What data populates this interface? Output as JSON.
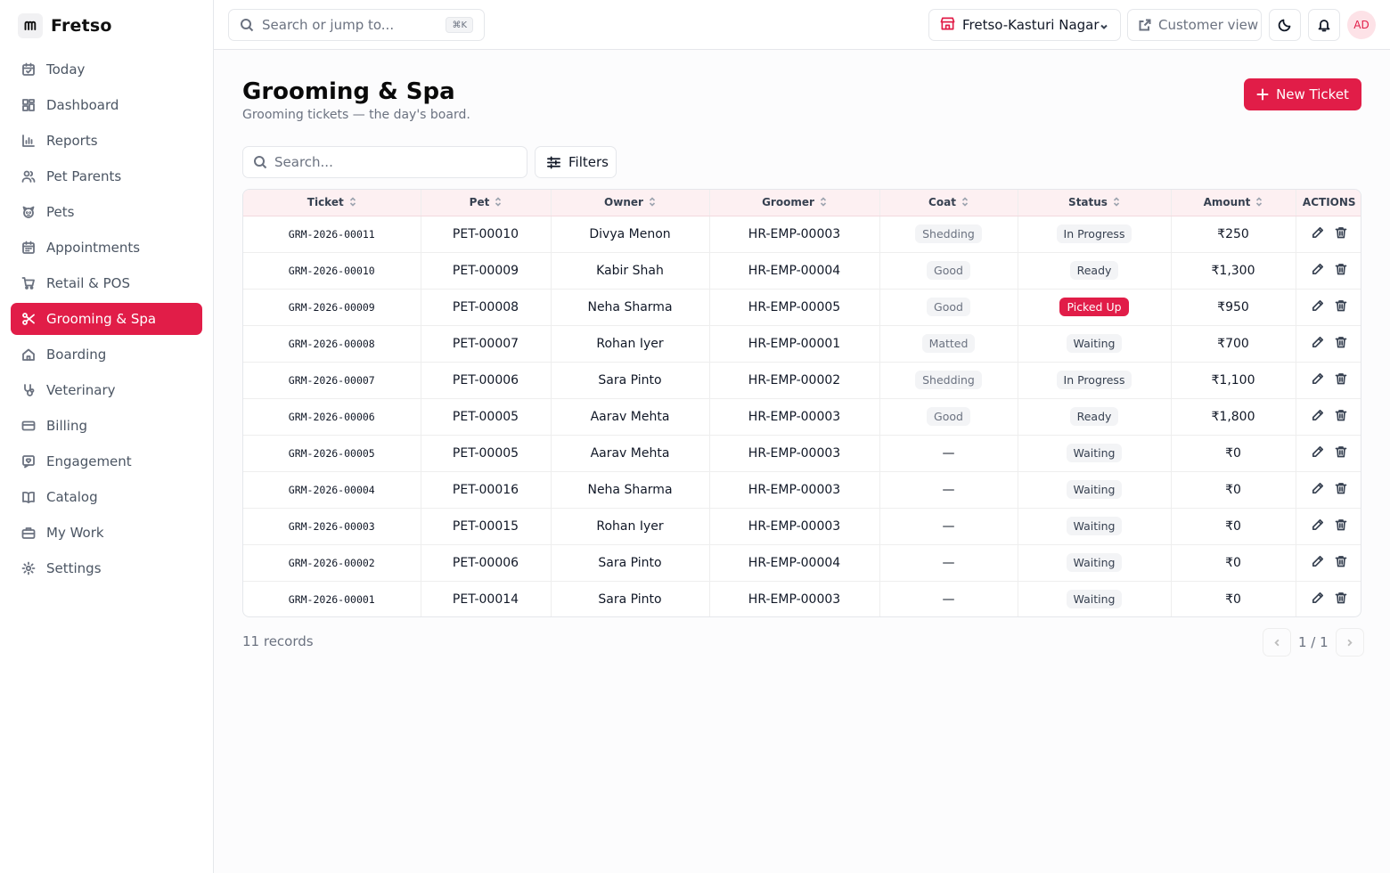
{
  "app": {
    "name": "Fretso",
    "logo_mark": "m"
  },
  "sidebar": {
    "items": [
      {
        "label": "Today",
        "icon": "calendar-icon"
      },
      {
        "label": "Dashboard",
        "icon": "dashboard-icon"
      },
      {
        "label": "Reports",
        "icon": "bar-chart-icon"
      },
      {
        "label": "Pet Parents",
        "icon": "users-icon"
      },
      {
        "label": "Pets",
        "icon": "paw-icon"
      },
      {
        "label": "Appointments",
        "icon": "calendar-grid-icon"
      },
      {
        "label": "Retail & POS",
        "icon": "cart-icon"
      },
      {
        "label": "Grooming & Spa",
        "icon": "scissors-icon",
        "active": true
      },
      {
        "label": "Boarding",
        "icon": "home-icon"
      },
      {
        "label": "Veterinary",
        "icon": "stethoscope-icon"
      },
      {
        "label": "Billing",
        "icon": "credit-card-icon"
      },
      {
        "label": "Engagement",
        "icon": "heart-message-icon"
      },
      {
        "label": "Catalog",
        "icon": "book-icon"
      },
      {
        "label": "My Work",
        "icon": "briefcase-icon"
      },
      {
        "label": "Settings",
        "icon": "gear-icon"
      }
    ]
  },
  "topbar": {
    "search_placeholder": "Search or jump to...",
    "shortcut": "⌘K",
    "branch": "Fretso-Kasturi Nagar",
    "customer_view": "Customer view",
    "avatar_initials": "AD"
  },
  "page": {
    "title": "Grooming & Spa",
    "subtitle": "Grooming tickets — the day's board.",
    "new_button": "New Ticket",
    "search_placeholder": "Search...",
    "filters_label": "Filters"
  },
  "table": {
    "columns": [
      "Ticket",
      "Pet",
      "Owner",
      "Groomer",
      "Coat",
      "Status",
      "Amount",
      "ACTIONS"
    ],
    "rows": [
      {
        "ticket": "GRM-2026-00011",
        "pet": "PET-00010",
        "owner": "Divya Menon",
        "groomer": "HR-EMP-00003",
        "coat": "Shedding",
        "status": "In Progress",
        "amount": "₹250"
      },
      {
        "ticket": "GRM-2026-00010",
        "pet": "PET-00009",
        "owner": "Kabir Shah",
        "groomer": "HR-EMP-00004",
        "coat": "Good",
        "status": "Ready",
        "amount": "₹1,300"
      },
      {
        "ticket": "GRM-2026-00009",
        "pet": "PET-00008",
        "owner": "Neha Sharma",
        "groomer": "HR-EMP-00005",
        "coat": "Good",
        "status": "Picked Up",
        "amount": "₹950"
      },
      {
        "ticket": "GRM-2026-00008",
        "pet": "PET-00007",
        "owner": "Rohan Iyer",
        "groomer": "HR-EMP-00001",
        "coat": "Matted",
        "status": "Waiting",
        "amount": "₹700"
      },
      {
        "ticket": "GRM-2026-00007",
        "pet": "PET-00006",
        "owner": "Sara Pinto",
        "groomer": "HR-EMP-00002",
        "coat": "Shedding",
        "status": "In Progress",
        "amount": "₹1,100"
      },
      {
        "ticket": "GRM-2026-00006",
        "pet": "PET-00005",
        "owner": "Aarav Mehta",
        "groomer": "HR-EMP-00003",
        "coat": "Good",
        "status": "Ready",
        "amount": "₹1,800"
      },
      {
        "ticket": "GRM-2026-00005",
        "pet": "PET-00005",
        "owner": "Aarav Mehta",
        "groomer": "HR-EMP-00003",
        "coat": "—",
        "status": "Waiting",
        "amount": "₹0"
      },
      {
        "ticket": "GRM-2026-00004",
        "pet": "PET-00016",
        "owner": "Neha Sharma",
        "groomer": "HR-EMP-00003",
        "coat": "—",
        "status": "Waiting",
        "amount": "₹0"
      },
      {
        "ticket": "GRM-2026-00003",
        "pet": "PET-00015",
        "owner": "Rohan Iyer",
        "groomer": "HR-EMP-00003",
        "coat": "—",
        "status": "Waiting",
        "amount": "₹0"
      },
      {
        "ticket": "GRM-2026-00002",
        "pet": "PET-00006",
        "owner": "Sara Pinto",
        "groomer": "HR-EMP-00004",
        "coat": "—",
        "status": "Waiting",
        "amount": "₹0"
      },
      {
        "ticket": "GRM-2026-00001",
        "pet": "PET-00014",
        "owner": "Sara Pinto",
        "groomer": "HR-EMP-00003",
        "coat": "—",
        "status": "Waiting",
        "amount": "₹0"
      }
    ]
  },
  "footer": {
    "records": "11 records",
    "page_indicator": "1 / 1"
  },
  "colors": {
    "accent": "#e11d48",
    "header_tint": "#fdf0f2"
  }
}
